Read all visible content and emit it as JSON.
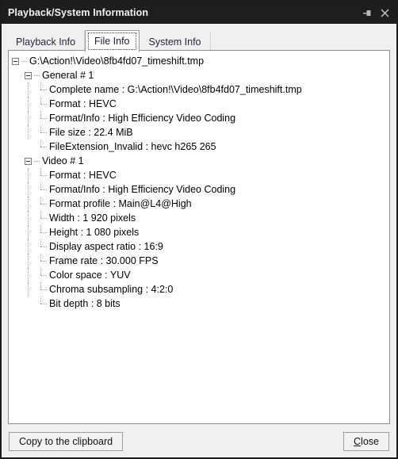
{
  "window": {
    "title": "Playback/System Information",
    "pin_icon": "pushpin-icon",
    "close_icon": "close-icon"
  },
  "tabs": [
    {
      "label": "Playback Info",
      "active": false
    },
    {
      "label": "File Info",
      "active": true
    },
    {
      "label": "System Info",
      "active": false
    }
  ],
  "tree": {
    "rows": [
      {
        "depth": 0,
        "type": "branch",
        "text": "G:\\Action!\\Video\\8fb4fd07_timeshift.tmp"
      },
      {
        "depth": 1,
        "type": "branch",
        "text": "General # 1"
      },
      {
        "depth": 2,
        "type": "leaf",
        "text": "Complete name : G:\\Action!\\Video\\8fb4fd07_timeshift.tmp"
      },
      {
        "depth": 2,
        "type": "leaf",
        "text": "Format : HEVC"
      },
      {
        "depth": 2,
        "type": "leaf",
        "text": "Format/Info : High Efficiency Video Coding"
      },
      {
        "depth": 2,
        "type": "leaf",
        "text": "File size : 22.4 MiB"
      },
      {
        "depth": 2,
        "type": "leaf",
        "text": "FileExtension_Invalid : hevc h265 265",
        "last": true
      },
      {
        "depth": 1,
        "type": "branch",
        "text": "Video # 1"
      },
      {
        "depth": 2,
        "type": "leaf",
        "text": "Format : HEVC"
      },
      {
        "depth": 2,
        "type": "leaf",
        "text": "Format/Info : High Efficiency Video Coding"
      },
      {
        "depth": 2,
        "type": "leaf",
        "text": "Format profile : Main@L4@High"
      },
      {
        "depth": 2,
        "type": "leaf",
        "text": "Width : 1 920 pixels"
      },
      {
        "depth": 2,
        "type": "leaf",
        "text": "Height : 1 080 pixels"
      },
      {
        "depth": 2,
        "type": "leaf",
        "text": "Display aspect ratio : 16:9"
      },
      {
        "depth": 2,
        "type": "leaf",
        "text": "Frame rate : 30.000 FPS"
      },
      {
        "depth": 2,
        "type": "leaf",
        "text": "Color space : YUV"
      },
      {
        "depth": 2,
        "type": "leaf",
        "text": "Chroma subsampling : 4:2:0"
      },
      {
        "depth": 2,
        "type": "leaf",
        "text": "Bit depth : 8 bits",
        "last": true
      }
    ]
  },
  "footer": {
    "copy_label": "Copy to the clipboard",
    "close_accel": "C",
    "close_rest": "lose"
  },
  "colors": {
    "titlebar_bg": "#1e1e1e",
    "chrome_bg": "#f0f0f0",
    "panel_bg": "#ffffff",
    "border": "#8d8d8d",
    "text": "#000000"
  }
}
